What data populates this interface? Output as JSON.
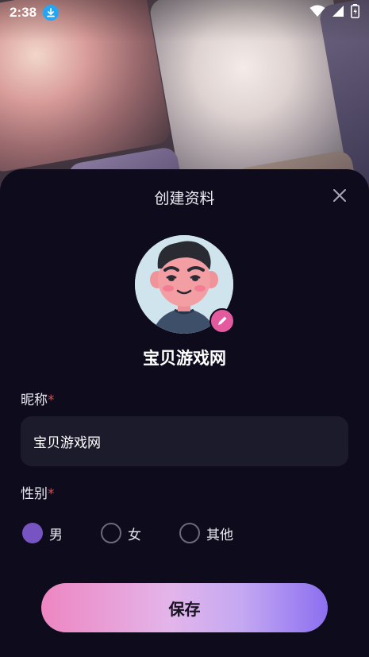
{
  "status_bar": {
    "time": "2:38",
    "icons": [
      "download-icon",
      "wifi-icon",
      "signal-icon",
      "battery-icon"
    ]
  },
  "sheet": {
    "title": "创建资料",
    "close_icon": "close-icon"
  },
  "profile": {
    "display_name": "宝贝游戏网",
    "edit_icon": "pencil-icon"
  },
  "form": {
    "nickname_label": "昵称",
    "nickname_value": "宝贝游戏网",
    "required_mark": "*",
    "gender_label": "性别",
    "gender_options": [
      {
        "label": "男",
        "selected": true
      },
      {
        "label": "女",
        "selected": false
      },
      {
        "label": "其他",
        "selected": false
      }
    ]
  },
  "save_label": "保存",
  "colors": {
    "background": "#0d0b1c",
    "input_bg": "#1c1b2c",
    "selected_radio": "#7654c2",
    "required": "#e5484d",
    "edit_badge": "#e45a9e",
    "button_gradient_start": "#ee86c1",
    "button_gradient_end": "#8c6ff0"
  }
}
